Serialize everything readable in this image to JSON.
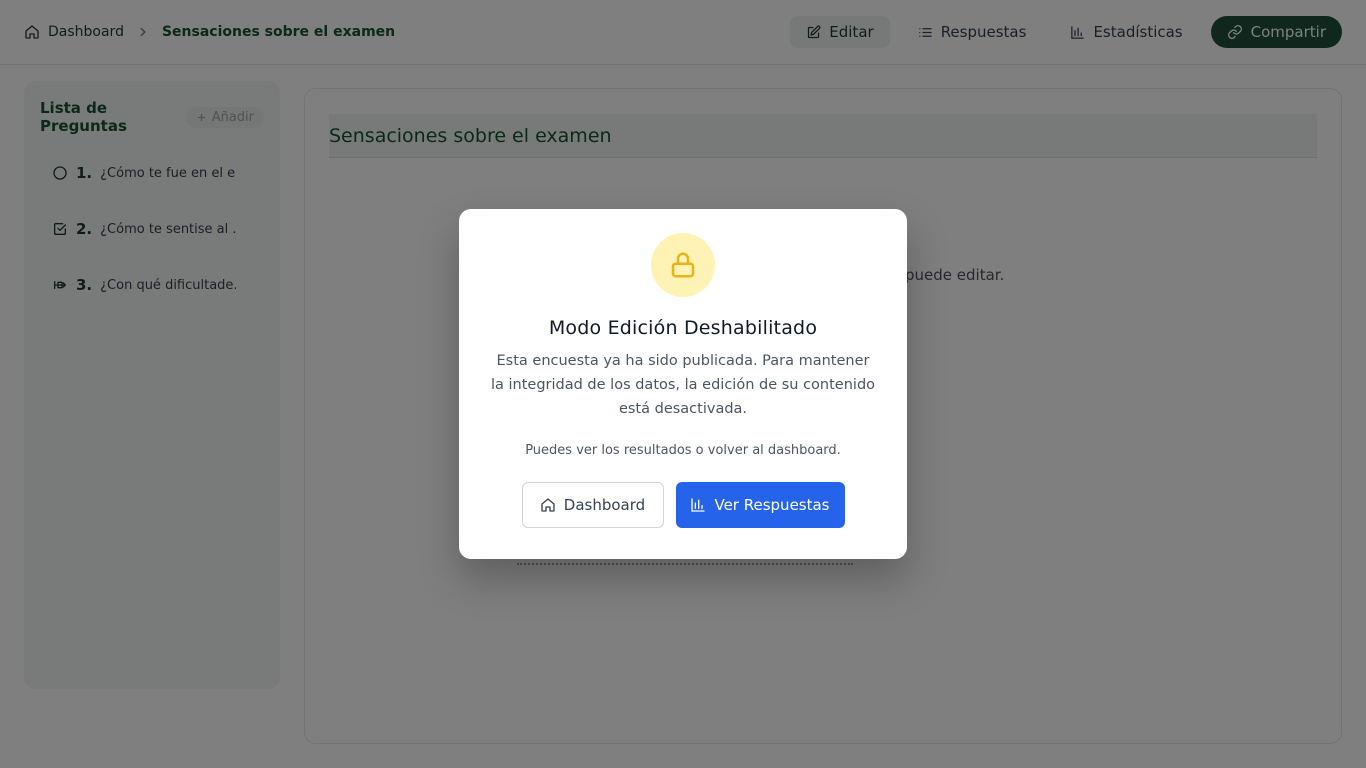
{
  "header": {
    "breadcrumb": {
      "home_label": "Dashboard",
      "current": "Sensaciones sobre el examen"
    },
    "nav": {
      "edit_label": "Editar",
      "responses_label": "Respuestas",
      "stats_label": "Estadísticas",
      "share_label": "Compartir"
    }
  },
  "sidebar": {
    "title": "Lista de Preguntas",
    "add_label": "Añadir",
    "questions": [
      {
        "number": "1.",
        "text": "¿Cómo te fue en el e...",
        "icon": "radio-circle-icon"
      },
      {
        "number": "2.",
        "text": "¿Cómo te sentise al ...",
        "icon": "checkbox-icon"
      },
      {
        "number": "3.",
        "text": "¿Con qué dificultade...",
        "icon": "rank-icon"
      }
    ]
  },
  "main": {
    "title": "Sensaciones sobre el examen",
    "note_partial": "puede editar."
  },
  "modal": {
    "icon": "lock-icon",
    "title": "Modo Edición Deshabilitado",
    "description": "Esta encuesta ya ha sido publicada. Para mantener la integridad de los datos, la edición de su contenido está desactivada.",
    "hint": "Puedes ver los resultados o volver al dashboard.",
    "dashboard_button": "Dashboard",
    "responses_button": "Ver Respuestas"
  },
  "colors": {
    "brand_green": "#1f4f3a",
    "primary_blue": "#2563eb",
    "lock_bg": "#fef3b4",
    "lock_icon": "#e7b416"
  }
}
